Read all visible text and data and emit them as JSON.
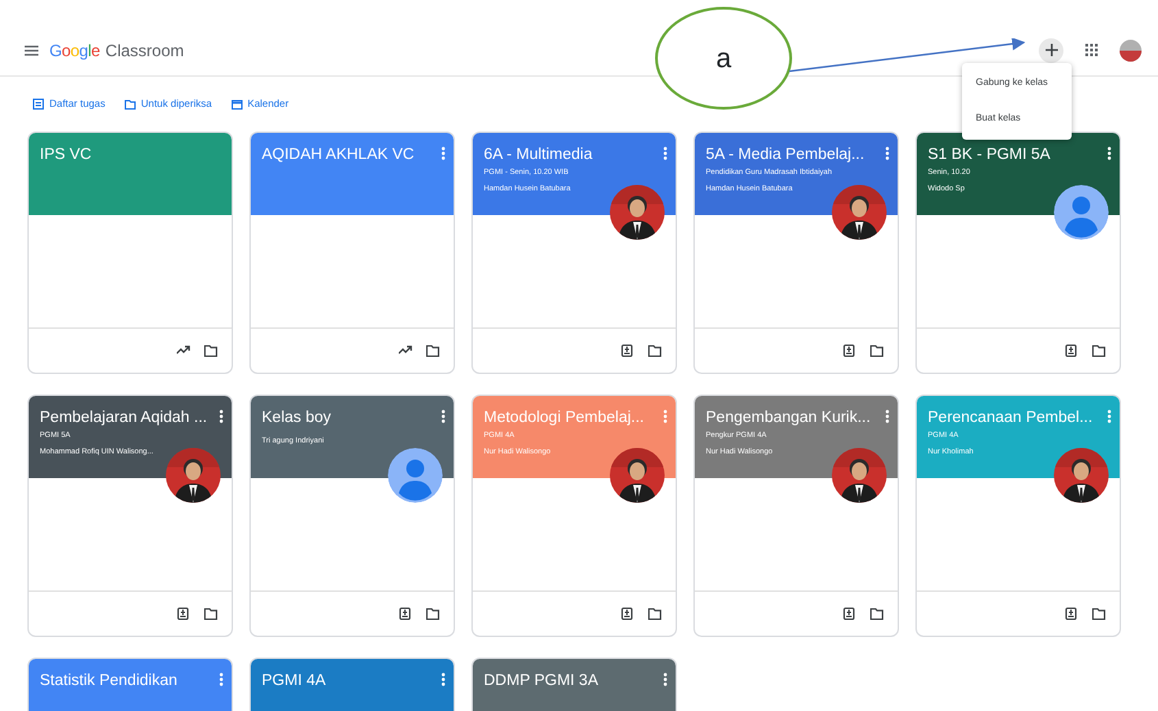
{
  "app_bar": {
    "logo_google": "Google",
    "logo_product": "Classroom"
  },
  "sub_nav": [
    {
      "label": "Daftar tugas"
    },
    {
      "label": "Untuk diperiksa"
    },
    {
      "label": "Kalender"
    }
  ],
  "add_menu": {
    "open": true,
    "items": [
      "Gabung ke kelas",
      "Buat kelas"
    ]
  },
  "annotation": {
    "label": "a"
  },
  "classes": [
    {
      "title": "IPS VC",
      "color": "#1f9a7d",
      "kind": "teacher",
      "menu": false
    },
    {
      "title": "AQIDAH AKHLAK VC",
      "color": "#4285f4",
      "kind": "teacher",
      "menu": true
    },
    {
      "title": "6A - Multimedia",
      "subtitle": "PGMI - Senin, 10.20 WIB",
      "teacher": "Hamdan Husein Batubara",
      "color": "#3b78e7",
      "kind": "student",
      "menu": true
    },
    {
      "title": "5A - Media Pembelaj...",
      "subtitle": "Pendidikan Guru Madrasah Ibtidaiyah",
      "teacher": "Hamdan Husein Batubara",
      "color": "#3a6fd8",
      "kind": "student",
      "menu": true
    },
    {
      "title": "S1 BK - PGMI 5A",
      "subtitle": "Senin, 10.20",
      "teacher": "Widodo Sp",
      "color": "#1b5a44",
      "kind": "student",
      "avatar": {
        "kind": "default"
      },
      "menu": true
    },
    {
      "title": "Pembelajaran Aqidah ...",
      "subtitle": "PGMI 5A",
      "teacher": "Mohammad Rofiq UIN Walisong...",
      "color": "#485259",
      "kind": "student",
      "menu": true
    },
    {
      "title": "Kelas boy",
      "teacher": "Tri agung Indriyani",
      "color": "#56666f",
      "kind": "student",
      "avatar": {
        "kind": "default"
      },
      "menu": true
    },
    {
      "title": "Metodologi Pembelaj...",
      "subtitle": "PGMI 4A",
      "teacher": "Nur Hadi Walisongo",
      "color": "#f6896a",
      "kind": "student",
      "menu": true
    },
    {
      "title": "Pengembangan Kurik...",
      "subtitle": "Pengkur PGMI 4A",
      "teacher": "Nur Hadi Walisongo",
      "color": "#7b7b7b",
      "kind": "student",
      "menu": true
    },
    {
      "title": "Perencanaan Pembel...",
      "subtitle": "PGMI 4A",
      "teacher": "Nur Kholimah",
      "color": "#1badc2",
      "kind": "student",
      "menu": true
    },
    {
      "title": "Statistik Pendidikan",
      "color": "#4285f4",
      "menu": true
    },
    {
      "title": "PGMI 4A",
      "color": "#1b7cc4",
      "menu": true
    },
    {
      "title": "DDMP PGMI 3A",
      "color": "#5d6b70",
      "menu": true
    }
  ]
}
